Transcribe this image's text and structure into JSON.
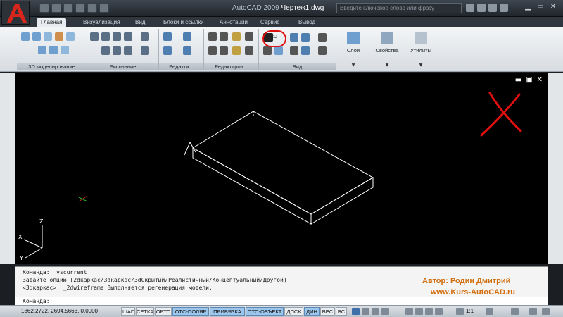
{
  "title_bar": {
    "app_name": "AutoCAD 2009",
    "document_name": "Чертеж1.dwg",
    "search_placeholder": "Введите ключевое слово или фразу"
  },
  "ribbon": {
    "tabs": [
      "Главная",
      "Визуализация",
      "Вид",
      "Блоки и ссылки",
      "Аннотации",
      "Сервис",
      "Вывод"
    ],
    "active_tab": "Главная",
    "panels": [
      "3D моделирование",
      "Рисование",
      "Редакти...",
      "Редактиров...",
      "Вид"
    ],
    "big_buttons": [
      "Слои",
      "Свойства",
      "Утилиты"
    ],
    "highlighted_control": "2D"
  },
  "viewport": {
    "controls": [
      "minimize-icon",
      "restore-icon",
      "close-icon"
    ],
    "ucs_labels": {
      "x": "X",
      "y": "Y",
      "z": "Z"
    },
    "annotation_color": "#e01010"
  },
  "command_line": {
    "history": [
      "Команда: _vscurrent",
      "Задайте опцию [2dкаркас/3dкаркас/3dСкрытый/Реалистичный/Концептуальный/Другой]",
      "<3dкаркас>: _2dwireframe Выполняется регенерация модели."
    ],
    "prompt": "Команда:"
  },
  "watermark": {
    "author": "Автор: Родин Дмитрий",
    "site": "www.Kurs-AutoCAD.ru"
  },
  "status_bar": {
    "coordinates": "1362.2722, 2694.5663, 0.0000",
    "toggles": [
      {
        "label": "ШАГ",
        "on": false
      },
      {
        "label": "СЕТКА",
        "on": false
      },
      {
        "label": "ОРТО",
        "on": false
      },
      {
        "label": "ОТС-ПОЛЯР",
        "on": true
      },
      {
        "label": "ПРИВЯЗКА",
        "on": true
      },
      {
        "label": "ОТС-ОБЪЕКТ",
        "on": true
      },
      {
        "label": "ДПСК",
        "on": false
      },
      {
        "label": "ДИН",
        "on": true
      },
      {
        "label": "ВЕС",
        "on": false
      },
      {
        "label": "БС",
        "on": false
      }
    ],
    "annotation_scale": "1:1"
  },
  "colors": {
    "drawing_background": "#000000",
    "wireframe": "#ffffff",
    "watermark": "#d26d0c",
    "toggle_on": "#9cc6ec"
  }
}
